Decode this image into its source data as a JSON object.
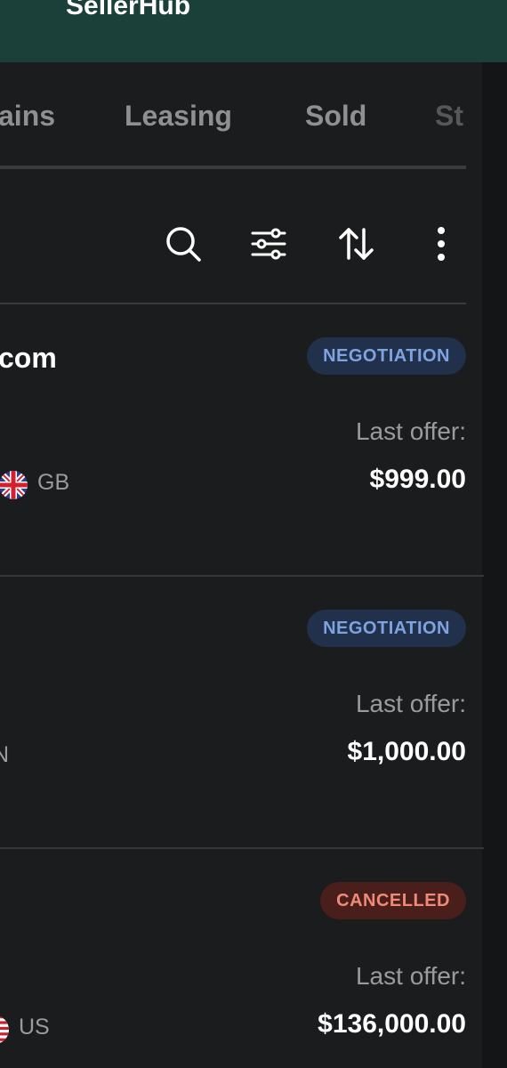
{
  "header": {
    "title": "SellerHub",
    "background": "#1b3f39"
  },
  "tabs": [
    {
      "label": "ains"
    },
    {
      "label": "Leasing"
    },
    {
      "label": "Sold"
    },
    {
      "label": "St"
    }
  ],
  "toolbar": {
    "icons": [
      "search-icon",
      "filter-sliders-icon",
      "sort-arrows-icon",
      "more-vertical-icon"
    ]
  },
  "rows": [
    {
      "title": "com",
      "status": "NEGOTIATION",
      "status_color": "#7fa3e0",
      "offer_label": "Last offer:",
      "offer_amount": "$999.00",
      "country": "GB",
      "flag_icon": "uk-flag-icon"
    },
    {
      "title": "",
      "status": "NEGOTIATION",
      "status_color": "#7fa3e0",
      "offer_label": "Last offer:",
      "offer_amount": "$1,000.00",
      "country": "N",
      "flag_icon": ""
    },
    {
      "title": "",
      "status": "CANCELLED",
      "status_color": "#f08a78",
      "offer_label": "Last offer:",
      "offer_amount": "$136,000.00",
      "country": "US",
      "flag_icon": "us-flag-icon"
    }
  ]
}
